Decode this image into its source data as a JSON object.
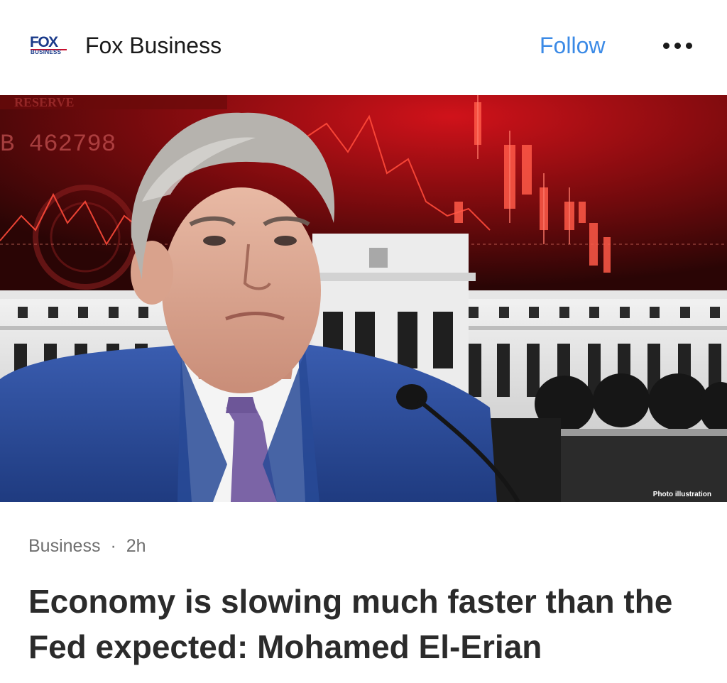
{
  "header": {
    "logo_top": "FOX",
    "logo_bottom": "BUSINESS",
    "publisher_name": "Fox Business",
    "follow_label": "Follow",
    "more_icon": "more-horizontal-icon"
  },
  "hero": {
    "background_text": "RESERVE",
    "serial_text": "B 462798",
    "caption": "Photo illustration"
  },
  "article": {
    "category": "Business",
    "separator": "·",
    "time": "2h",
    "headline": "Economy is slowing much faster than the Fed expected: Mohamed El-Erian"
  },
  "colors": {
    "follow": "#3b8ae6",
    "text_primary": "#1a1a1a",
    "text_secondary": "#6f6f6f",
    "headline": "#2b2b2b",
    "hero_red": "#c8141a"
  }
}
